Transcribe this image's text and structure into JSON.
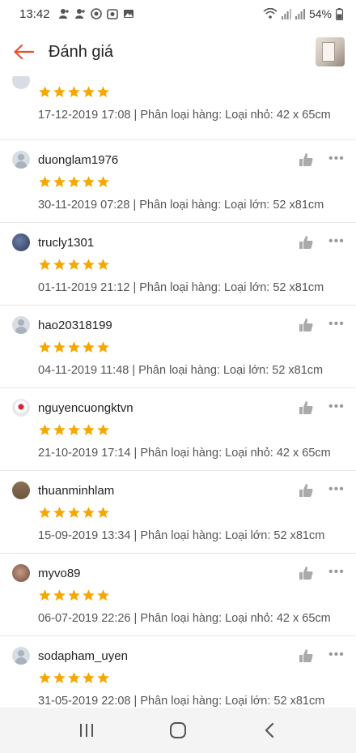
{
  "status": {
    "time": "13:42",
    "battery": "54%",
    "icons": [
      "person-add-icon",
      "person-add-icon",
      "vpn-icon",
      "camera-icon",
      "image-icon"
    ]
  },
  "header": {
    "title": "Đánh giá",
    "back_icon": "arrow-left-icon",
    "accent": "#ee4d2d"
  },
  "colors": {
    "star": "#f6a700",
    "divider": "#e6e6e6"
  },
  "reviews": [
    {
      "username": "",
      "rating": 5,
      "date": "17-12-2019 17:08",
      "variant": "Phân loại hàng: Loại nhỏ: 42 x 65cm"
    },
    {
      "username": "duonglam1976",
      "rating": 5,
      "date": "30-11-2019 07:28",
      "variant": "Phân loại hàng: Loại lớn: 52 x81cm"
    },
    {
      "username": "trucly1301",
      "rating": 5,
      "date": "01-11-2019 21:12",
      "variant": "Phân loại hàng: Loại lớn: 52 x81cm"
    },
    {
      "username": "hao20318199",
      "rating": 5,
      "date": "04-11-2019 11:48",
      "variant": "Phân loại hàng: Loại lớn: 52 x81cm"
    },
    {
      "username": "nguyencuongktvn",
      "rating": 5,
      "date": "21-10-2019 17:14",
      "variant": "Phân loại hàng: Loại nhỏ: 42 x 65cm"
    },
    {
      "username": "thuanminhlam",
      "rating": 5,
      "date": "15-09-2019 13:34",
      "variant": "Phân loại hàng: Loại lớn: 52 x81cm"
    },
    {
      "username": "myvo89",
      "rating": 5,
      "date": "06-07-2019 22:26",
      "variant": "Phân loại hàng: Loại nhỏ: 42 x 65cm"
    },
    {
      "username": "sodapham_uyen",
      "rating": 5,
      "date": "31-05-2019 22:08",
      "variant": "Phân loại hàng: Loại lớn: 52 x81cm"
    }
  ],
  "separator": " | ",
  "nav": {
    "recent_icon": "recent-apps-icon",
    "home_icon": "home-icon",
    "back_icon": "back-icon"
  }
}
